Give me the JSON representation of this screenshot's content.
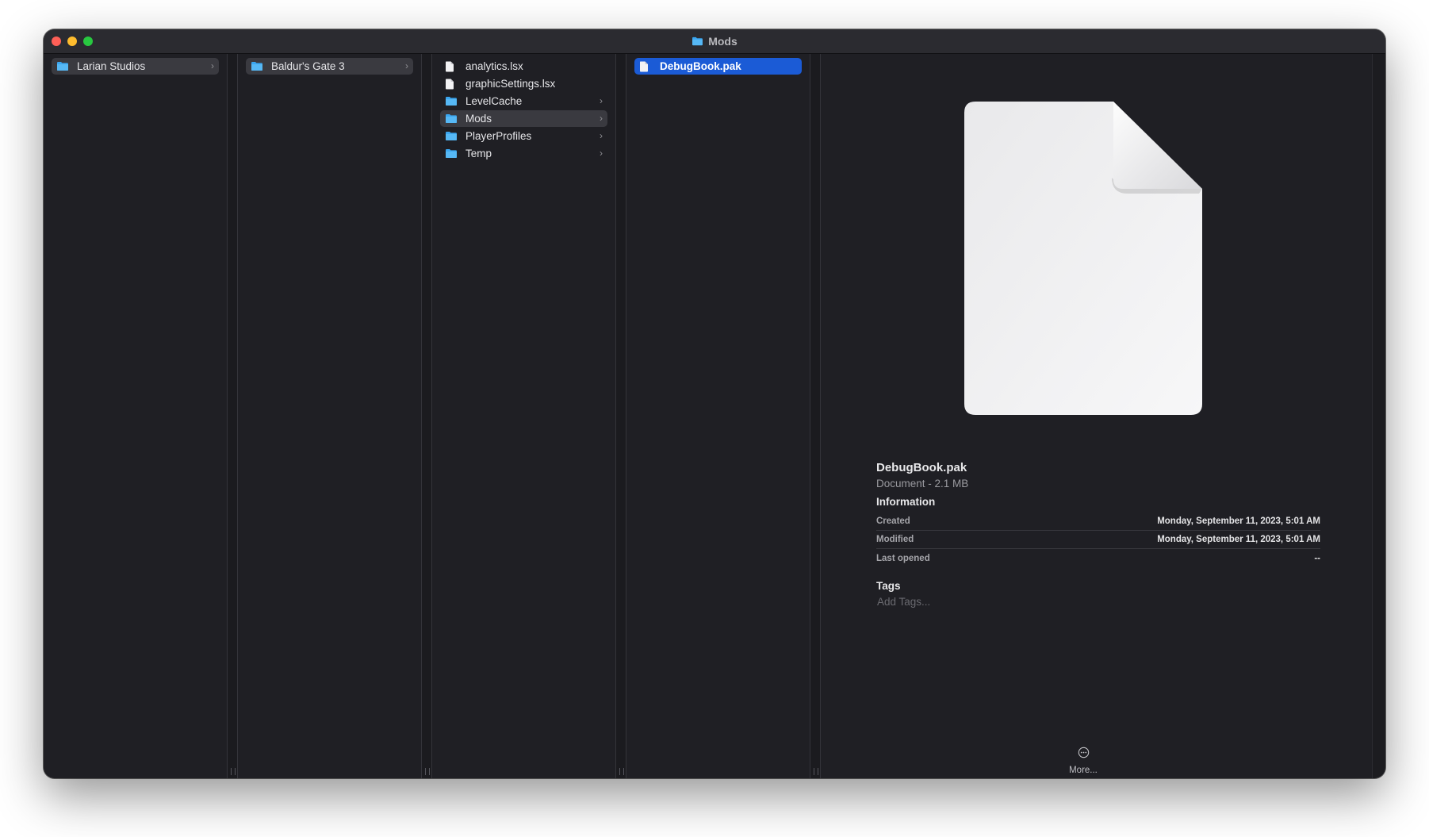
{
  "window": {
    "title": "Mods",
    "title_icon": "folder-icon"
  },
  "colors": {
    "window_bg": "#1f1f24",
    "selection": "#1b5bd6",
    "path_highlight": "#3a3a40",
    "folder_blue": "#3aa6f0"
  },
  "columns": [
    {
      "items": [
        {
          "label": "Larian Studios",
          "icon": "folder-icon",
          "has_children": true,
          "state": "path"
        }
      ]
    },
    {
      "items": [
        {
          "label": "Baldur's Gate 3",
          "icon": "folder-icon",
          "has_children": true,
          "state": "path"
        }
      ]
    },
    {
      "items": [
        {
          "label": "analytics.lsx",
          "icon": "document-icon",
          "has_children": false,
          "state": "none"
        },
        {
          "label": "graphicSettings.lsx",
          "icon": "document-icon",
          "has_children": false,
          "state": "none"
        },
        {
          "label": "LevelCache",
          "icon": "folder-icon",
          "has_children": true,
          "state": "none"
        },
        {
          "label": "Mods",
          "icon": "folder-icon",
          "has_children": true,
          "state": "path"
        },
        {
          "label": "PlayerProfiles",
          "icon": "folder-icon",
          "has_children": true,
          "state": "none"
        },
        {
          "label": "Temp",
          "icon": "folder-icon",
          "has_children": true,
          "state": "none"
        }
      ]
    },
    {
      "items": [
        {
          "label": "DebugBook.pak",
          "icon": "document-icon",
          "has_children": false,
          "state": "selected"
        }
      ]
    }
  ],
  "preview": {
    "thumbnail_icon": "document-icon",
    "file_name": "DebugBook.pak",
    "file_kind": "Document - 2.1 MB",
    "information_heading": "Information",
    "info": [
      {
        "key": "Created",
        "value": "Monday, September 11, 2023, 5:01 AM"
      },
      {
        "key": "Modified",
        "value": "Monday, September 11, 2023, 5:01 AM"
      },
      {
        "key": "Last opened",
        "value": "--"
      }
    ],
    "tags_heading": "Tags",
    "tags_placeholder": "Add Tags...",
    "more_label": "More..."
  }
}
